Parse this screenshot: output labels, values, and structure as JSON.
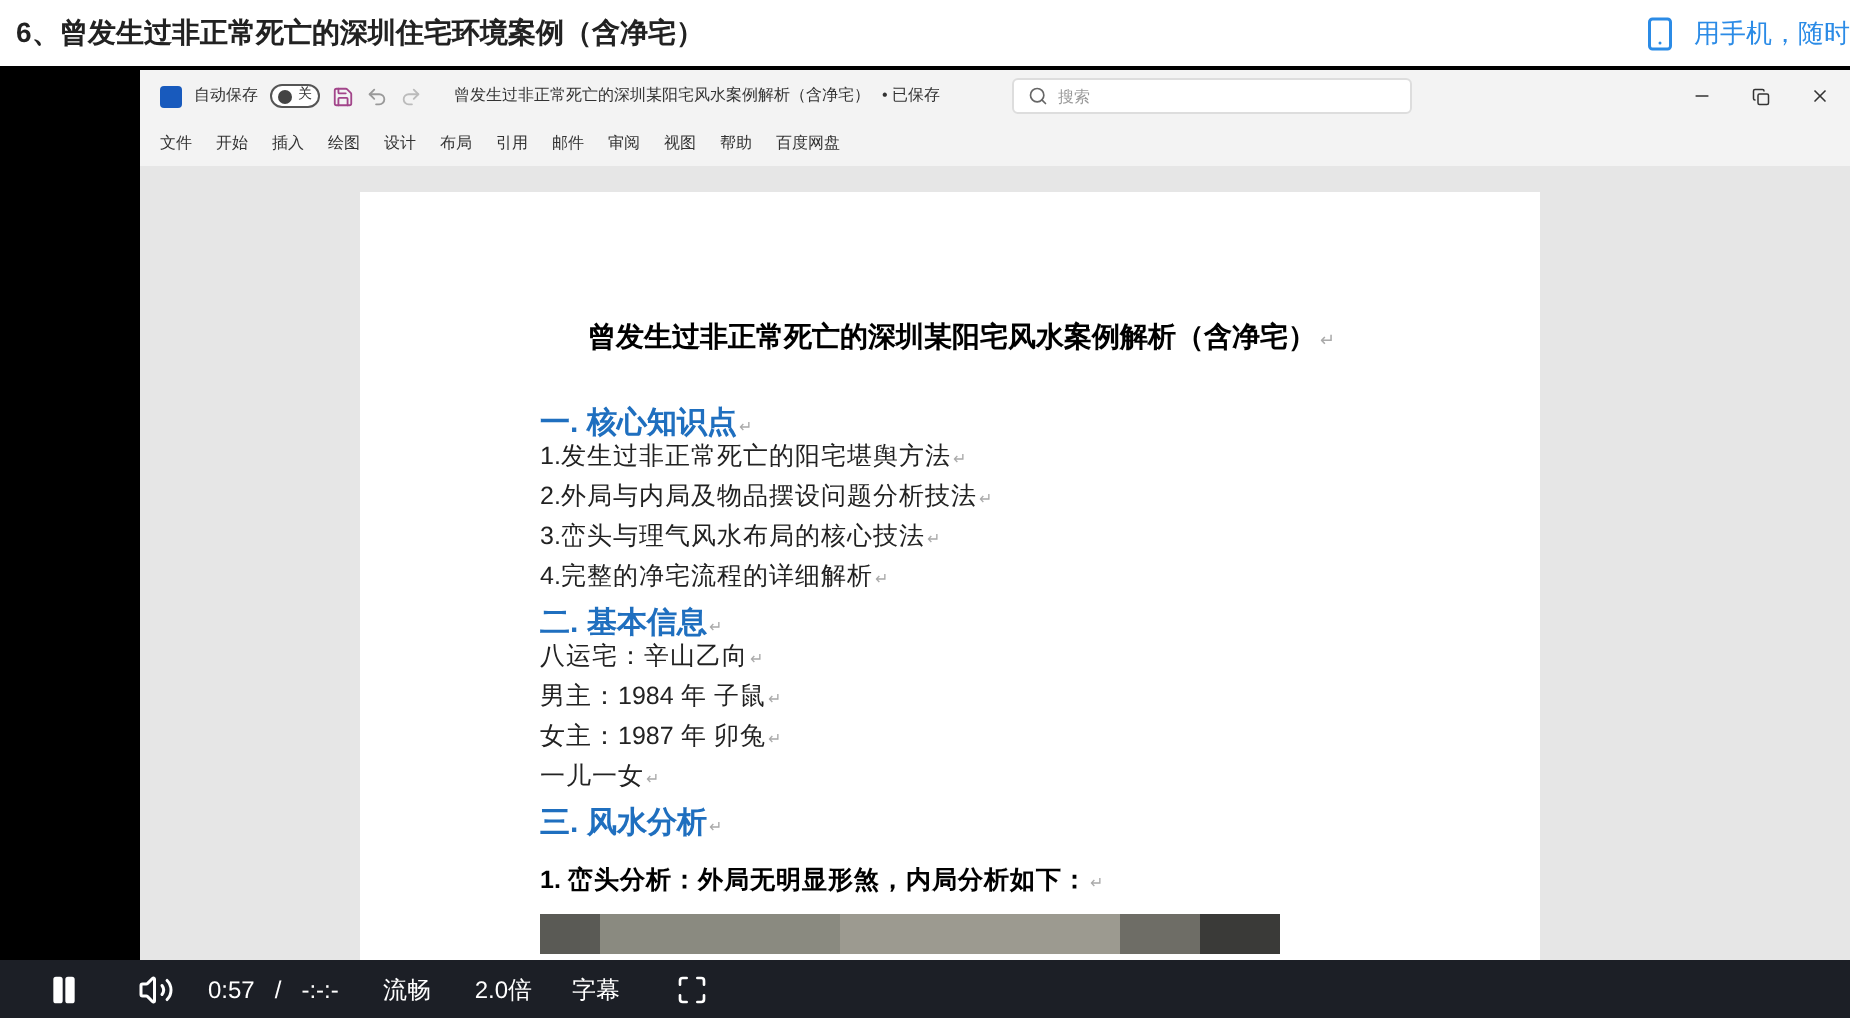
{
  "page_title": "6、曾发生过非正常死亡的深圳住宅环境案例（含净宅）",
  "mobile_link": "用手机，随时",
  "word": {
    "autosave_label": "自动保存",
    "autosave_on": false,
    "autosave_state": "关",
    "doc_title": "曾发生过非正常死亡的深圳某阳宅风水案例解析（含净宅）",
    "save_status": "• 已保存",
    "search_placeholder": "搜索",
    "ribbon_tabs": [
      {
        "label": "文件",
        "selected": false
      },
      {
        "label": "开始",
        "selected": false
      },
      {
        "label": "插入",
        "selected": false
      },
      {
        "label": "绘图",
        "selected": false
      },
      {
        "label": "设计",
        "selected": false
      },
      {
        "label": "布局",
        "selected": false
      },
      {
        "label": "引用",
        "selected": false
      },
      {
        "label": "邮件",
        "selected": false
      },
      {
        "label": "审阅",
        "selected": false
      },
      {
        "label": "视图",
        "selected": false
      },
      {
        "label": "帮助",
        "selected": false
      },
      {
        "label": "百度网盘",
        "selected": false
      }
    ]
  },
  "document": {
    "para_mark": "↵",
    "title": "曾发生过非正常死亡的深圳某阳宅风水案例解析（含净宅）",
    "lines": [
      {
        "kind": "heading",
        "text": "一. 核心知识点"
      },
      {
        "kind": "text",
        "text": "1.发生过非正常死亡的阳宅堪舆方法"
      },
      {
        "kind": "text",
        "text": "2.外局与内局及物品摆设问题分析技法"
      },
      {
        "kind": "text",
        "text": "3.峦头与理气风水布局的核心技法"
      },
      {
        "kind": "text",
        "text": "4.完整的净宅流程的详细解析"
      },
      {
        "kind": "heading",
        "text": "二. 基本信息"
      },
      {
        "kind": "text",
        "text": "八运宅：辛山乙向"
      },
      {
        "kind": "text",
        "text": "男主：1984 年  子鼠"
      },
      {
        "kind": "text",
        "text": "女主：1987 年  卯兔"
      },
      {
        "kind": "text",
        "text": "一儿一女"
      },
      {
        "kind": "heading",
        "text": "三. 风水分析"
      },
      {
        "kind": "bold",
        "text": "1. 峦头分析：外局无明显形煞，内局分析如下："
      }
    ]
  },
  "player": {
    "playing": true,
    "time": "0:57",
    "separator": "/",
    "duration": "-:-:-",
    "quality": "流畅",
    "speed": "2.0倍",
    "subtitles": "字幕"
  }
}
